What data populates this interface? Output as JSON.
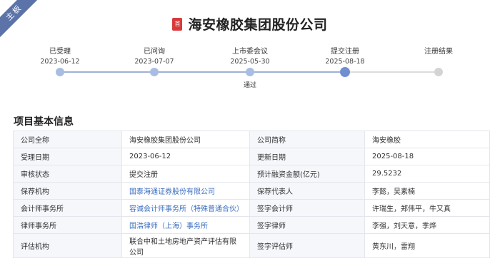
{
  "board_ribbon": "主板",
  "company": {
    "badge": "首",
    "name": "海安橡胶集团股份公司"
  },
  "timeline": {
    "steps": [
      {
        "label": "已受理",
        "date": "2023-06-12",
        "state": "done",
        "note": ""
      },
      {
        "label": "已问询",
        "date": "2023-07-07",
        "state": "done",
        "note": ""
      },
      {
        "label": "上市委会议",
        "date": "2025-05-30",
        "state": "done",
        "note": "通过"
      },
      {
        "label": "提交注册",
        "date": "2025-08-18",
        "state": "current",
        "note": ""
      },
      {
        "label": "注册结果",
        "date": "",
        "state": "pending",
        "note": ""
      }
    ]
  },
  "section_title": "项目基本信息",
  "info": {
    "rows": [
      [
        {
          "label": "公司全称",
          "value": "海安橡胶集团股份公司",
          "link": false
        },
        {
          "label": "公司简称",
          "value": "海安橡胶",
          "link": false
        }
      ],
      [
        {
          "label": "受理日期",
          "value": "2023-06-12",
          "link": false
        },
        {
          "label": "更新日期",
          "value": "2025-08-18",
          "link": false
        }
      ],
      [
        {
          "label": "审核状态",
          "value": "提交注册",
          "link": false
        },
        {
          "label": "预计融资金额(亿元)",
          "value": "29.5232",
          "link": false
        }
      ],
      [
        {
          "label": "保荐机构",
          "value": "国泰海通证券股份有限公司",
          "link": true
        },
        {
          "label": "保荐代表人",
          "value": "李懿，吴素楠",
          "link": false
        }
      ],
      [
        {
          "label": "会计师事务所",
          "value": "容诚会计师事务所（特殊普通合伙）",
          "link": true
        },
        {
          "label": "签字会计师",
          "value": "许瑞生，郑伟平，牛又真",
          "link": false
        }
      ],
      [
        {
          "label": "律师事务所",
          "value": "国浩律师（上海）事务所",
          "link": true
        },
        {
          "label": "签字律师",
          "value": "李强，刘天意，季烨",
          "link": false
        }
      ],
      [
        {
          "label": "评估机构",
          "value": "联合中和土地房地产资产评估有限公司",
          "link": false
        },
        {
          "label": "签字评估师",
          "value": "黄东川，雷翔",
          "link": false
        }
      ]
    ]
  }
}
